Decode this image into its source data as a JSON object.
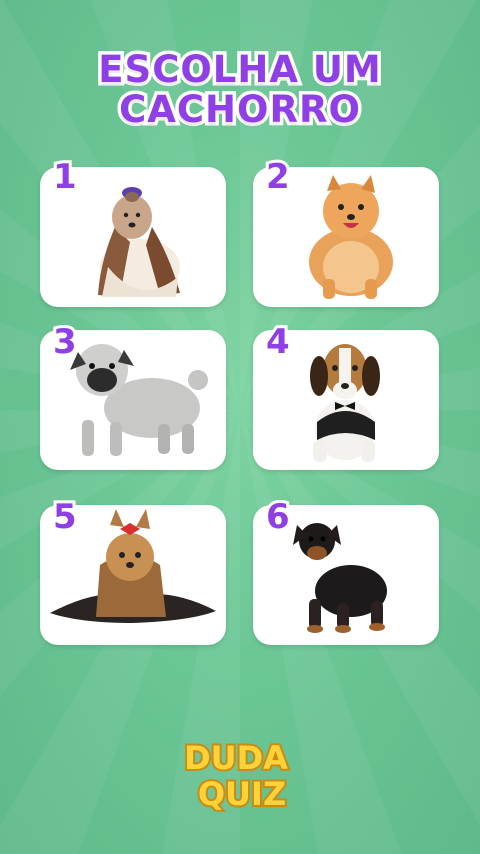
{
  "title": {
    "line1": "ESCOLHA UM",
    "line2": "CACHORRO"
  },
  "options": [
    {
      "number": "1",
      "dog_icon": "shih-tzu-dog"
    },
    {
      "number": "2",
      "dog_icon": "pomeranian-dog"
    },
    {
      "number": "3",
      "dog_icon": "pug-dog"
    },
    {
      "number": "4",
      "dog_icon": "beagle-dog"
    },
    {
      "number": "5",
      "dog_icon": "yorkshire-dog"
    },
    {
      "number": "6",
      "dog_icon": "pinscher-dog"
    }
  ],
  "logo": {
    "line1": "DUDA",
    "line2": "QUIZ"
  },
  "colors": {
    "accent_purple": "#8f3fe6",
    "background_green": "#6cc796",
    "logo_yellow": "#ffd23a"
  }
}
